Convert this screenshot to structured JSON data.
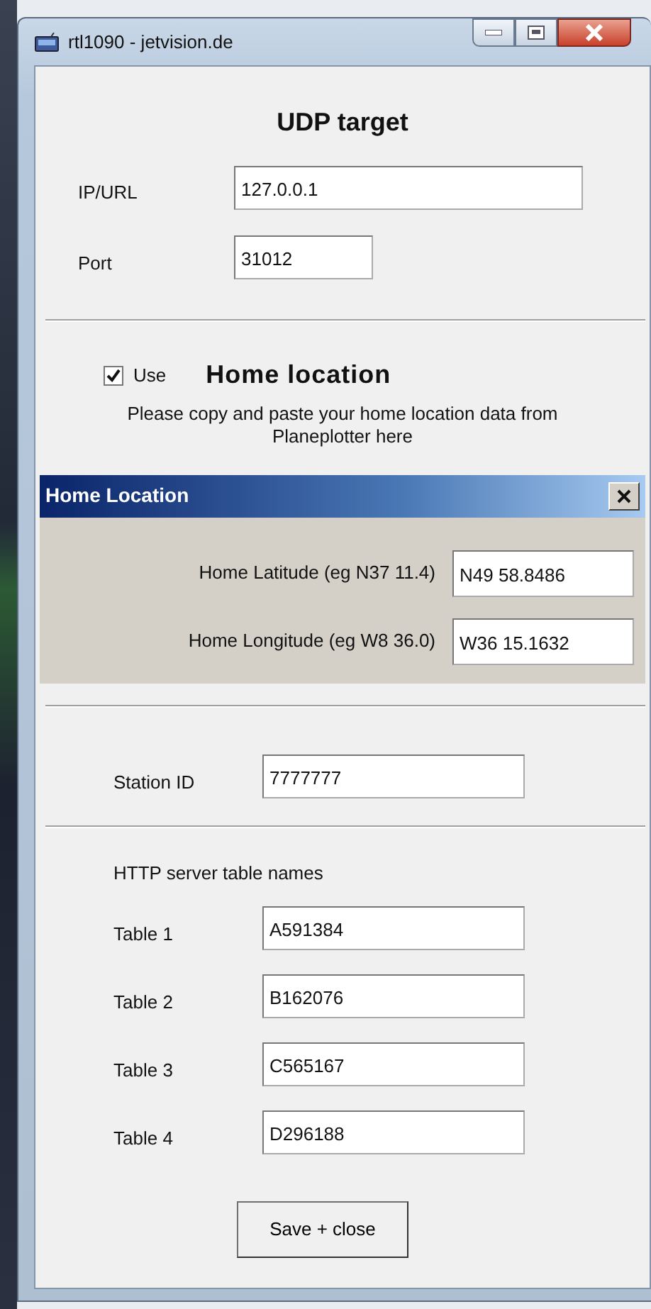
{
  "window": {
    "title": "rtl1090 - jetvision.de"
  },
  "udp_target": {
    "heading": "UDP target",
    "fields": [
      {
        "label": "IP/URL",
        "value": "127.0.0.1"
      },
      {
        "label": "Port",
        "value": "31012"
      }
    ]
  },
  "home_location": {
    "use_checkbox": {
      "label": "Use",
      "checked": true
    },
    "heading": "Home location",
    "description": "Please copy and paste your home location data from Planeplotter here",
    "dialog": {
      "title": "Home Location",
      "fields": [
        {
          "label": "Home Latitude (eg N37 11.4)",
          "value": "N49 58.8486"
        },
        {
          "label": "Home Longitude (eg W8 36.0)",
          "value": "W36 15.1632"
        }
      ]
    }
  },
  "station": {
    "label": "Station ID",
    "value": "7777777"
  },
  "http_tables": {
    "heading": "HTTP server table names",
    "fields": [
      {
        "label": "Table 1",
        "value": "A591384"
      },
      {
        "label": "Table 2",
        "value": "B162076"
      },
      {
        "label": "Table 3",
        "value": "C565167"
      },
      {
        "label": "Table 4",
        "value": "D296188"
      }
    ]
  },
  "save_button": {
    "label": "Save + close"
  }
}
